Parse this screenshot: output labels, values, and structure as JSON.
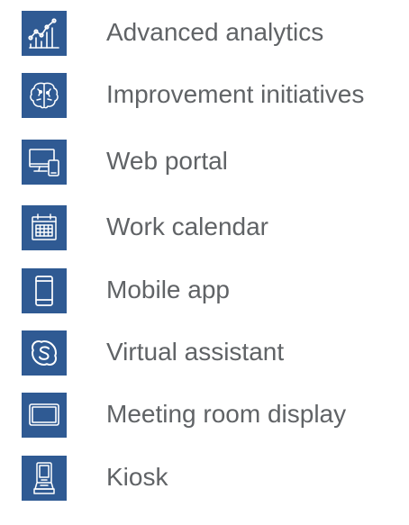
{
  "features": [
    {
      "label": "Advanced analytics",
      "icon": "analytics-chart-icon"
    },
    {
      "label": "Improvement initiatives",
      "icon": "brain-icon"
    },
    {
      "label": "Web portal",
      "icon": "desktop-and-tablet-icon"
    },
    {
      "label": "Work calendar",
      "icon": "calendar-icon"
    },
    {
      "label": "Mobile app",
      "icon": "mobile-phone-icon"
    },
    {
      "label": "Virtual assistant",
      "icon": "skype-logo-icon"
    },
    {
      "label": "Meeting room display",
      "icon": "wall-display-icon"
    },
    {
      "label": "Kiosk",
      "icon": "kiosk-icon"
    }
  ],
  "colors": {
    "tile_background": "#2f5a93",
    "icon_line": "#ffffff",
    "label_text": "#606366"
  }
}
